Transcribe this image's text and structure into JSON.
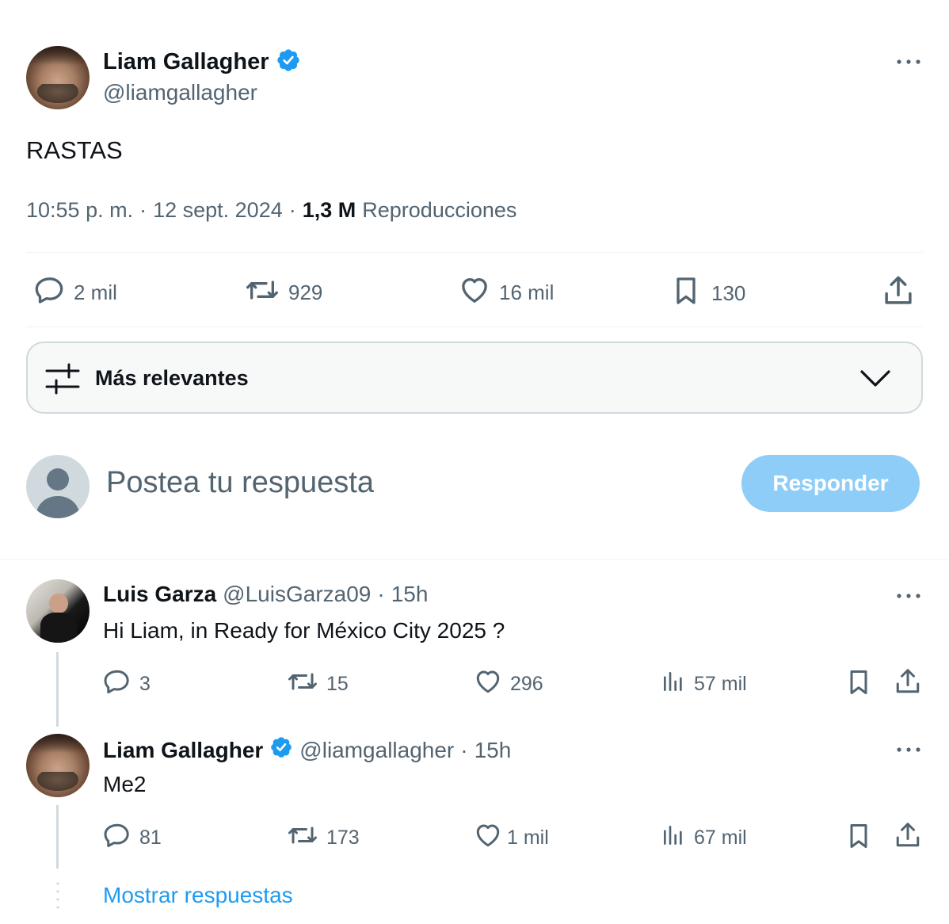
{
  "tweet": {
    "author_name": "Liam Gallagher",
    "author_handle": "@liamgallagher",
    "text": "RASTAS",
    "time": "10:55 p. m.",
    "date": "12 sept. 2024",
    "separator": "·",
    "views_count": "1,3 M",
    "views_label": "Reproducciones",
    "stats": {
      "replies": "2 mil",
      "retweets": "929",
      "likes": "16 mil",
      "bookmarks": "130"
    }
  },
  "sort": {
    "label": "Más relevantes"
  },
  "composer": {
    "placeholder": "Postea tu respuesta",
    "button_label": "Responder"
  },
  "replies": [
    {
      "name": "Luis Garza",
      "handle": "@LuisGarza09",
      "time": "15h",
      "text": "Hi Liam, in Ready for México City 2025 ?",
      "replies": "3",
      "retweets": "15",
      "likes": "296",
      "views": "57 mil"
    },
    {
      "name": "Liam Gallagher",
      "handle": "@liamgallagher",
      "time": "15h",
      "text": "Me2",
      "replies": "81",
      "retweets": "173",
      "likes": "1 mil",
      "views": "67 mil"
    }
  ],
  "show_replies_label": "Mostrar respuestas",
  "colors": {
    "accent": "#1d9bf0",
    "accent_disabled": "#8ecdf7",
    "muted": "#536471",
    "border": "#cfd9de"
  }
}
